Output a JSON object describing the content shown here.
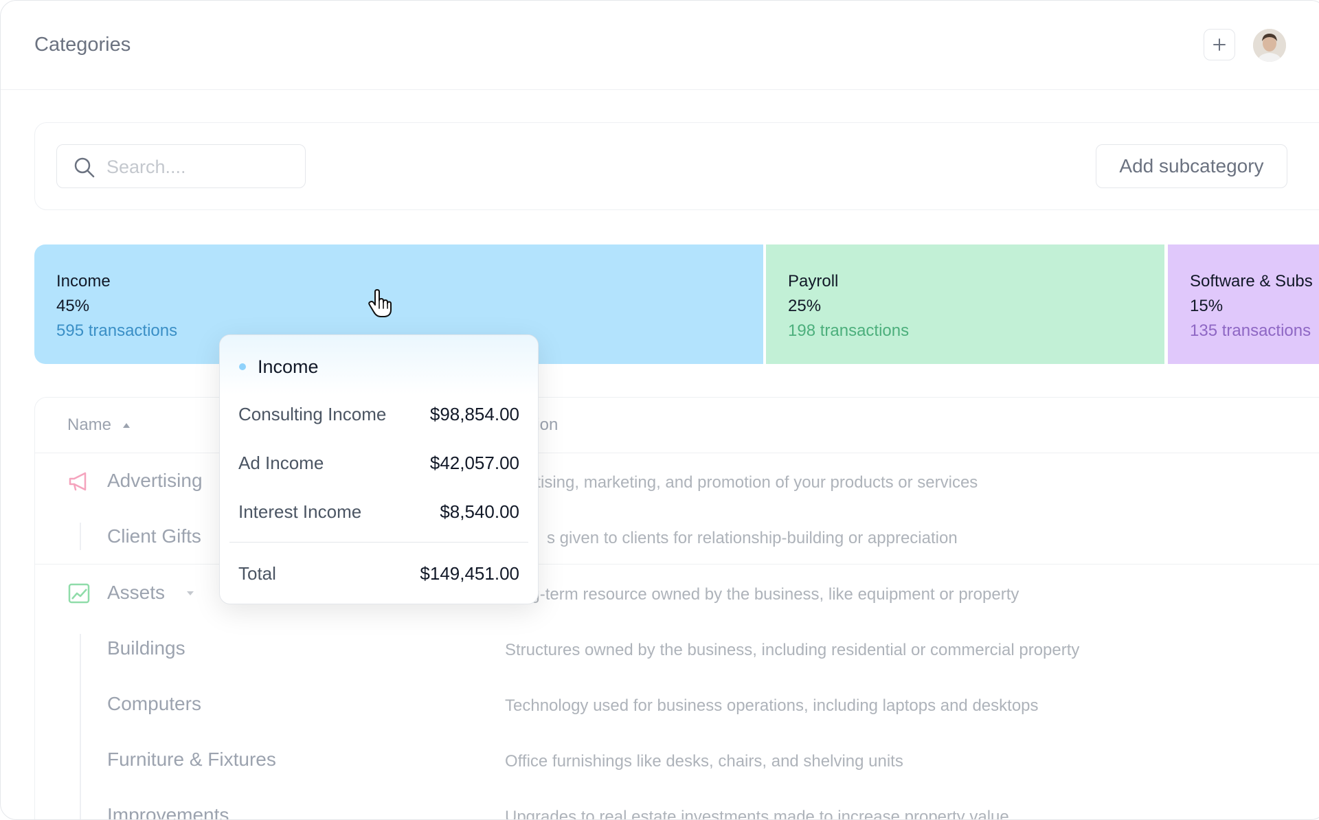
{
  "header": {
    "title": "Categories"
  },
  "toolbar": {
    "search_placeholder": "Search....",
    "add_subcategory_label": "Add subcategory"
  },
  "breakdown": [
    {
      "name": "Income",
      "percent": "45%",
      "transactions": "595 transactions",
      "color": "#b3e3fd"
    },
    {
      "name": "Payroll",
      "percent": "25%",
      "transactions": "198 transactions",
      "color": "#c2f0d6"
    },
    {
      "name": "Software & Subs",
      "percent": "15%",
      "transactions": "135 transactions",
      "color": "#e0c8fb"
    }
  ],
  "tooltip": {
    "title": "Income",
    "lines": [
      {
        "label": "Consulting Income",
        "value": "$98,854.00"
      },
      {
        "label": "Ad Income",
        "value": "$42,057.00"
      },
      {
        "label": "Interest Income",
        "value": "$8,540.00"
      }
    ],
    "total_label": "Total",
    "total_value": "$149,451.00"
  },
  "table": {
    "columns": {
      "name": "Name",
      "description": "cription"
    },
    "rows": [
      {
        "name": "Advertising",
        "description": "ertising, marketing, and promotion of your products or services"
      },
      {
        "name": "Client Gifts",
        "description": "s given to clients for relationship-building or appreciation"
      },
      {
        "name": "Assets",
        "description": "ng-term resource owned by the business, like equipment or property"
      },
      {
        "name": "Buildings",
        "description": "Structures owned by the business, including residential or commercial property"
      },
      {
        "name": "Computers",
        "description": "Technology used for business operations, including laptops and desktops"
      },
      {
        "name": "Furniture & Fixtures",
        "description": "Office furnishings like desks, chairs, and shelving units"
      },
      {
        "name": "Improvements",
        "description": "Upgrades to real estate investments made to increase property value"
      }
    ]
  },
  "colors": {
    "advertising_icon": "#f5a3bd",
    "assets_icon": "#8fdca9"
  },
  "icons": [
    "plus-icon",
    "avatar",
    "search-icon",
    "pointer-hand-icon",
    "sort-up-icon",
    "megaphone-icon",
    "chart-line-icon",
    "chevron-down-icon"
  ]
}
